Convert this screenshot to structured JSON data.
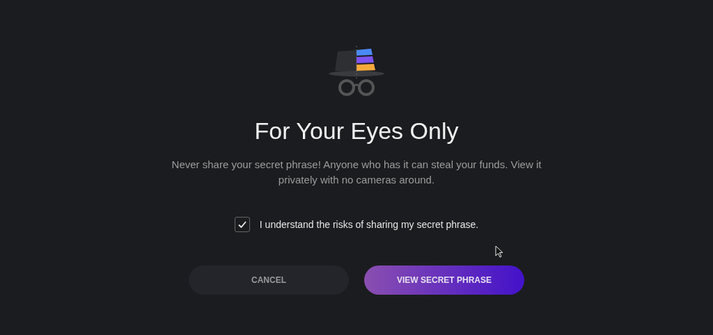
{
  "modal": {
    "title": "For Your Eyes Only",
    "message": "Never share your secret phrase! Anyone who has it can steal your funds. View it privately with no cameras around.",
    "consent": {
      "label": "I understand the risks of sharing my secret phrase.",
      "checked": true
    },
    "buttons": [
      {
        "label": "CANCEL",
        "kind": "secondary"
      },
      {
        "label": "VIEW SECRET PHRASE",
        "kind": "primary"
      }
    ]
  }
}
